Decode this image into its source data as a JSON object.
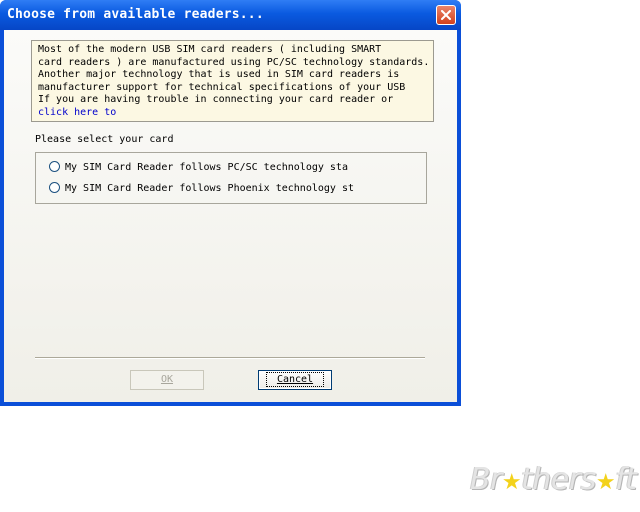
{
  "window": {
    "title": "Choose from available readers...",
    "close_icon": "close-icon"
  },
  "info": {
    "lines": [
      "Most  of  the  modern  USB SIM card readers ( including SMART",
      "card readers ) are manufactured using PC/SC technology standards.",
      "Another major technology that is used in SIM card readers is",
      "manufacturer support for technical specifications of your USB",
      "If you are having trouble in connecting your card reader or"
    ],
    "link": "click here to"
  },
  "select_label": "Please select your card",
  "options": [
    {
      "label": "My SIM Card Reader follows PC/SC technology sta",
      "selected": false
    },
    {
      "label": "My SIM Card Reader follows Phoenix technology st",
      "selected": false
    }
  ],
  "buttons": {
    "ok": "OK",
    "ok_enabled": false,
    "cancel": "Cancel"
  },
  "watermark": {
    "part1": "Br",
    "part2": "thers",
    "part3": "ft"
  },
  "colors": {
    "titlebar": "#0a5ae0",
    "info_bg": "#fcf8e3",
    "link": "#0000cc",
    "watermark_star": "#f3d21b"
  }
}
